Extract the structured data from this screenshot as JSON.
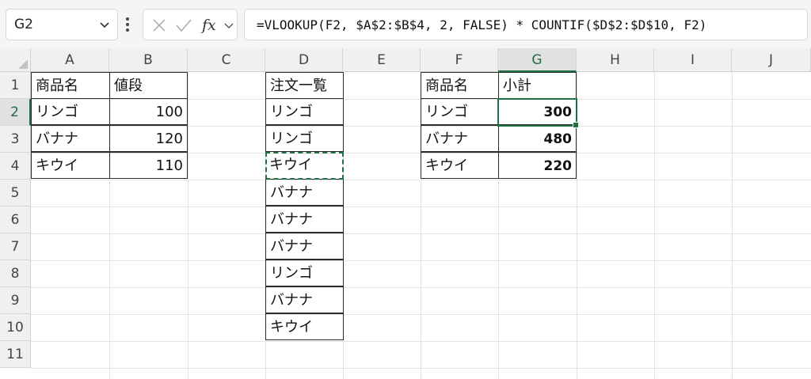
{
  "formula_bar": {
    "name_box": "G2",
    "formula": "=VLOOKUP(F2, $A$2:$B$4, 2, FALSE) * COUNTIF($D$2:$D$10, F2)"
  },
  "columns": [
    "A",
    "B",
    "C",
    "D",
    "E",
    "F",
    "G",
    "H",
    "I",
    "J"
  ],
  "rows": [
    "1",
    "2",
    "3",
    "4",
    "5",
    "6",
    "7",
    "8",
    "9",
    "10",
    "11"
  ],
  "price_table": {
    "header": [
      "商品名",
      "値段"
    ],
    "rows": [
      {
        "item": "リンゴ",
        "price": "100"
      },
      {
        "item": "バナナ",
        "price": "120"
      },
      {
        "item": "キウイ",
        "price": "110"
      }
    ]
  },
  "order_list": {
    "header": "注文一覧",
    "items": [
      "リンゴ",
      "リンゴ",
      "キウイ",
      "バナナ",
      "バナナ",
      "バナナ",
      "リンゴ",
      "バナナ",
      "キウイ"
    ]
  },
  "subtotal_table": {
    "header": [
      "商品名",
      "小計"
    ],
    "rows": [
      {
        "item": "リンゴ",
        "subtotal": "300"
      },
      {
        "item": "バナナ",
        "subtotal": "480"
      },
      {
        "item": "キウイ",
        "subtotal": "220"
      }
    ]
  },
  "icons": {
    "name_box_dropdown": "chevron-down-icon",
    "more": "vertical-dots-icon",
    "cancel": "x-icon",
    "enter": "check-icon",
    "insert_function": "fx-icon",
    "formula_expand": "chevron-down-icon"
  },
  "colors": {
    "accent_green": "#1e7145",
    "header_bg": "#f0f0f0"
  }
}
